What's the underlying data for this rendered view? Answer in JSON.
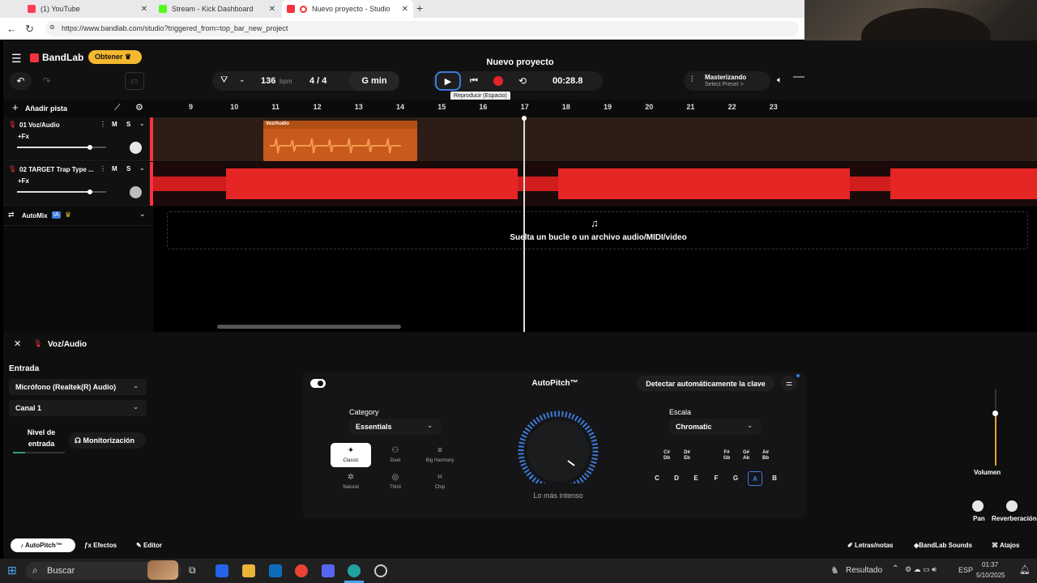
{
  "browser": {
    "tabs": [
      {
        "title": "(1) YouTube",
        "color": "#ff3d55"
      },
      {
        "title": "Stream - Kick Dashboard",
        "color": "#53fc18"
      },
      {
        "title": "Nuevo proyecto - Studio",
        "color": "#f5333f"
      }
    ],
    "new_tab": "+",
    "url": "https://www.bandlab.com/studio?triggered_from=top_bar_new_project"
  },
  "header": {
    "logo": "BandLab",
    "upgrade_label": "Obtener",
    "project_title": "Nuevo proyecto",
    "bpm_value": "136",
    "bpm_unit": "bpm",
    "time_sig": "4 / 4",
    "key": "G min",
    "time": "00:28.8",
    "tooltip": "Reproducir (Espacio)",
    "mastering_title": "Masterizando",
    "mastering_sub": "Select Preset >"
  },
  "tracks_panel": {
    "add_track": "Añadir pista",
    "tracks": [
      {
        "name": "01  Voz/Audio",
        "fx": "+Fx",
        "mute": "M",
        "solo": "S",
        "volume": 0.82
      },
      {
        "name": "02  TARGET Trap Type ...",
        "fx": "+Fx",
        "mute": "M",
        "solo": "S",
        "volume": 0.82
      }
    ],
    "automix": "AutoMix",
    "automix_badge": "IA"
  },
  "ruler": [
    "9",
    "10",
    "11",
    "12",
    "13",
    "14",
    "15",
    "16",
    "17",
    "18",
    "19",
    "20",
    "21",
    "22",
    "23"
  ],
  "timeline": {
    "clip_label": "Voz/Audio",
    "drop_text": "Suelta un bucle o un archivo audio/MIDI/video"
  },
  "panel": {
    "title": "Voz/Audio",
    "input_label": "Entrada",
    "input_device": "Micrófono (Realtek(R) Audio)",
    "channel": "Canal 1",
    "level_label": "Nivel de entrada",
    "monitor_label": "Monitorización",
    "autopitch": {
      "title": "AutoPitch™",
      "detect_key": "Detectar automáticamente la clave",
      "category_label": "Category",
      "category_value": "Essentials",
      "presets": [
        "Classic",
        "Duet",
        "Big Harmony",
        "Natural",
        "Third",
        "Chip"
      ],
      "knob_label": "Lo más intenso",
      "scale_label": "Escala",
      "scale_value": "Chromatic",
      "sharps": [
        "C#\nDb",
        "D#\nEb",
        "F#\nGb",
        "G#\nAb",
        "A#\nBb"
      ],
      "naturals": [
        "C",
        "D",
        "E",
        "F",
        "G",
        "A",
        "B"
      ],
      "selected_key": "A"
    },
    "right": {
      "volume": "Volumen",
      "pan": "Pan",
      "reverb": "Reverberación"
    }
  },
  "bottom_bar": {
    "tabs": [
      "AutoPitch™",
      "Efectos",
      "Editor"
    ],
    "right": [
      "Letras/notas",
      "BandLab Sounds",
      "Atajos"
    ]
  },
  "taskbar": {
    "search": "Buscar",
    "result": "Resultado",
    "lang": "ESP",
    "time": "01:37",
    "date": "5/10/2025"
  },
  "colors": {
    "accent": "#f5333f",
    "clip_orange": "#c75a1c",
    "blue": "#3d7bd9",
    "upgrade": "#f5b82e"
  }
}
